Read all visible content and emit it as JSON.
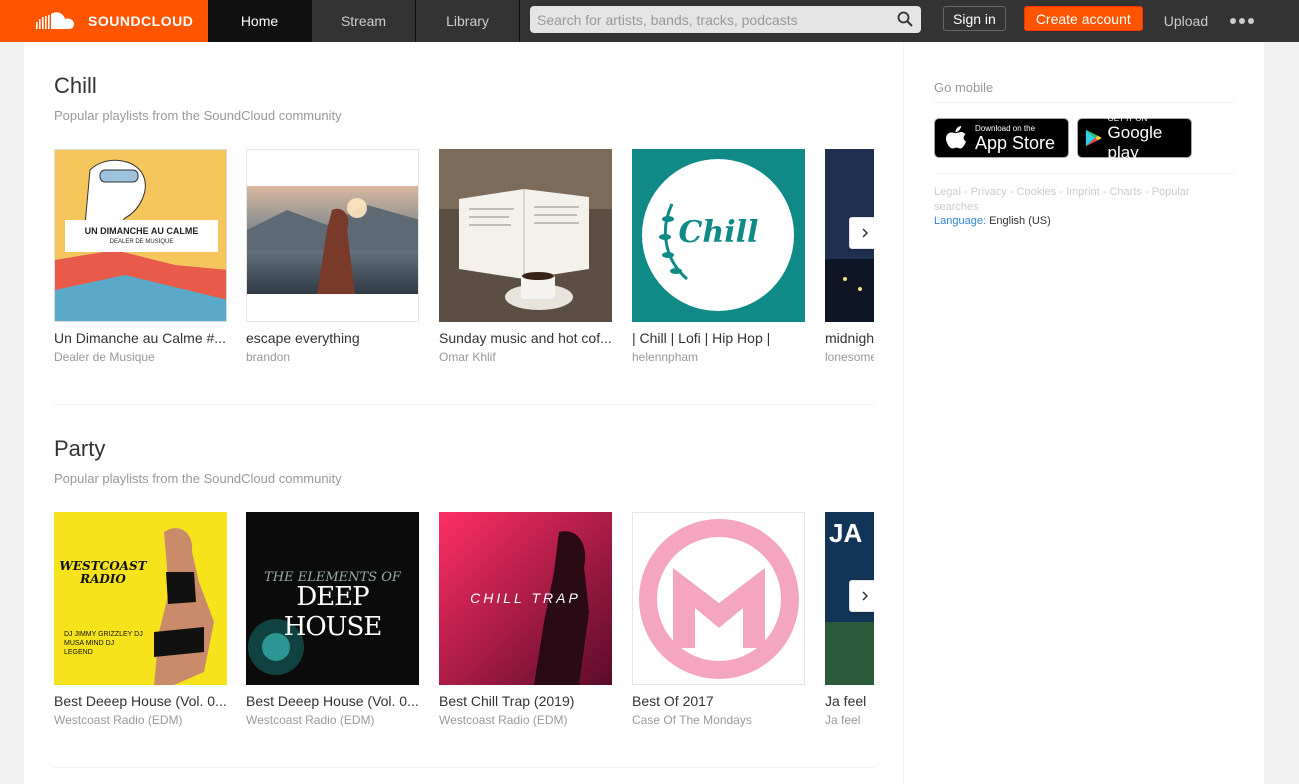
{
  "header": {
    "logo_text": "SOUNDCLOUD",
    "tabs": [
      {
        "label": "Home",
        "active": true
      },
      {
        "label": "Stream",
        "active": false
      },
      {
        "label": "Library",
        "active": false
      }
    ],
    "search_placeholder": "Search for artists, bands, tracks, podcasts",
    "signin_label": "Sign in",
    "create_label": "Create account",
    "upload_label": "Upload",
    "accent_color": "#ff5500"
  },
  "sections": [
    {
      "title": "Chill",
      "subtitle": "Popular playlists from the SoundCloud community",
      "cards": [
        {
          "title": "Un Dimanche au Calme #...",
          "user": "Dealer de Musique",
          "art_text_1": "UN DIMANCHE AU CALME",
          "art_text_2": "DEALER DE MUSIQUE"
        },
        {
          "title": "escape everything",
          "user": "brandon"
        },
        {
          "title": "Sunday music and hot cof...",
          "user": "Omar Khlif"
        },
        {
          "title": "| Chill | Lofi | Hip Hop |",
          "user": "helennpham",
          "art_text_1": "Chill"
        },
        {
          "title": "midnigh",
          "user": "lonesome"
        }
      ]
    },
    {
      "title": "Party",
      "subtitle": "Popular playlists from the SoundCloud community",
      "cards": [
        {
          "title": "Best Deeep House (Vol. 0...",
          "user": "Westcoast Radio (EDM)",
          "art_text_1": "WESTCOAST RADIO",
          "art_text_2": "DJ JIMMY GRIZZLEY DJ MUSA MIND DJ LEGEND"
        },
        {
          "title": "Best Deeep House (Vol. 0...",
          "user": "Westcoast Radio (EDM)",
          "art_text_1": "THE ELEMENTS OF",
          "art_text_2": "DEEP HOUSE"
        },
        {
          "title": "Best Chill Trap (2019)",
          "user": "Westcoast Radio (EDM)",
          "art_text_1": "CHILL TRAP"
        },
        {
          "title": "Best Of 2017",
          "user": "Case Of The Mondays"
        },
        {
          "title": "Ja feel",
          "user": "Ja feel",
          "art_text_1": "JA"
        }
      ]
    }
  ],
  "sidebar": {
    "go_mobile": "Go mobile",
    "appstore_small": "Download on the",
    "appstore_big": "App Store",
    "googleplay_small": "GET IT ON",
    "googleplay_big": "Google play",
    "links": [
      "Legal",
      "Privacy",
      "Cookies",
      "Imprint",
      "Charts",
      "Popular searches"
    ],
    "language_label": "Language:",
    "language_value": "English (US)"
  }
}
